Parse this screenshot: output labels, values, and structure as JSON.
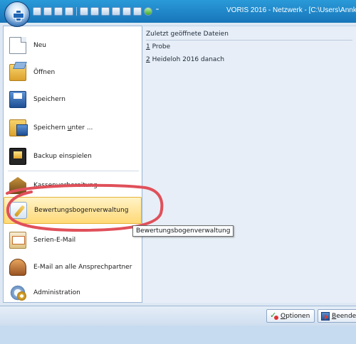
{
  "window": {
    "title": "VORIS 2016 - Netzwerk - [C:\\Users\\Annkat"
  },
  "quick_access": {
    "icons": [
      "save-icon",
      "print-icon",
      "book-icon",
      "people-icon",
      "list-icon",
      "list-icon",
      "edit-icon",
      "edit-icon",
      "edit-icon",
      "form-icon",
      "refresh-icon"
    ],
    "more_glyph": "⁼"
  },
  "menu": {
    "items": [
      {
        "label": "Neu",
        "icon": "new-document-icon"
      },
      {
        "label": "Öffnen",
        "icon": "open-folder-icon"
      },
      {
        "label": "Speichern",
        "icon": "save-disk-icon"
      },
      {
        "label_pre": "Speichern ",
        "label_hot": "u",
        "label_post": "nter ...",
        "icon": "save-as-icon"
      },
      {
        "label": "Backup einspielen",
        "icon": "backup-icon"
      },
      {
        "label": "Kassenvorbereitung",
        "icon": "bank-icon"
      },
      {
        "label": "Bewertungsbogenverwaltung",
        "icon": "wrench-icon"
      },
      {
        "label": "Serien-E-Mail",
        "icon": "mail-icon"
      },
      {
        "label": "E-Mail an alle Ansprechpartner",
        "icon": "contacts-icon"
      },
      {
        "label": "Administration",
        "icon": "admin-icon"
      }
    ],
    "highlighted_index": 6
  },
  "recent": {
    "header": "Zuletzt geöffnete Dateien",
    "items": [
      {
        "num": "1",
        "name": "Probe"
      },
      {
        "num": "2",
        "name": "Heideloh 2016 danach"
      }
    ]
  },
  "buttons": {
    "options_hot": "O",
    "options_rest": "ptionen",
    "exit_hot": "B",
    "exit_rest": "eenden"
  },
  "tooltip": {
    "text": "Bewertungsbogenverwaltung"
  },
  "annotation": {
    "color": "#e0505a"
  }
}
